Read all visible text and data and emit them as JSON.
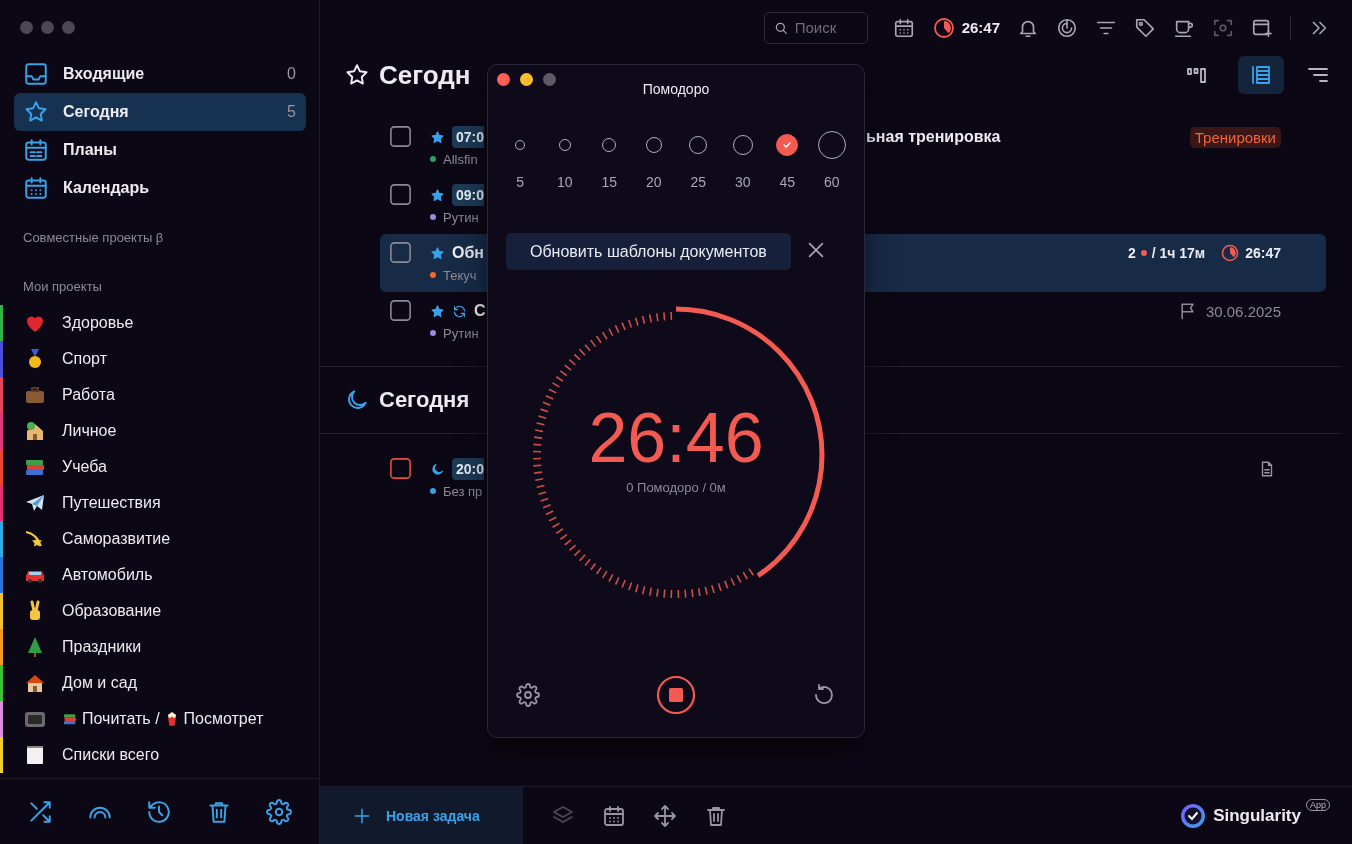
{
  "sidebar": {
    "nav": [
      {
        "label": "Входящие",
        "count": "0",
        "kind": "inbox",
        "selected": false
      },
      {
        "label": "Сегодня",
        "count": "5",
        "kind": "star",
        "selected": true
      },
      {
        "label": "Планы",
        "kind": "plans",
        "selected": false
      },
      {
        "label": "Календарь",
        "kind": "calendar",
        "selected": false
      }
    ],
    "shared_heading": "Совместные проекты β",
    "projects_heading": "Мои проекты",
    "projects": [
      {
        "title": "Здоровье",
        "kind": "heart",
        "color": "#33b249"
      },
      {
        "title": "Спорт",
        "kind": "medal",
        "color": "#4b4fd6"
      },
      {
        "title": "Работа",
        "kind": "briefcase",
        "color": "#e0475a"
      },
      {
        "title": "Личное",
        "kind": "house-tree",
        "color": "#e0367f"
      },
      {
        "title": "Учеба",
        "kind": "books",
        "color": "#e8452d"
      },
      {
        "title": "Путешествия",
        "kind": "plane",
        "color": "#e52e6f"
      },
      {
        "title": "Саморазвитие",
        "kind": "comet",
        "color": "#2fa9e0"
      },
      {
        "title": "Автомобиль",
        "kind": "car",
        "color": "#2d73d9"
      },
      {
        "title": "Образование",
        "kind": "hand",
        "color": "#f2c230"
      },
      {
        "title": "Праздники",
        "kind": "tree",
        "color": "#f29a1f"
      },
      {
        "title": "Дом и сад",
        "kind": "house",
        "color": "#3cc13b"
      },
      {
        "title": "Почитать /",
        "title_cont": "Посмотрет",
        "kind": "tv",
        "color": "#d98ee0"
      },
      {
        "title": "Списки всего",
        "kind": "notepad",
        "color": "#f2d02b"
      }
    ]
  },
  "topbar": {
    "search": {
      "placeholder": "Поиск"
    },
    "timer": "26:47"
  },
  "header": {
    "title": "Сегодн",
    "views": [
      {
        "kind": "columns",
        "selected": false
      },
      {
        "kind": "list",
        "selected": true
      }
    ]
  },
  "tasks": [
    {
      "kind": "star",
      "checked": false,
      "selected": false,
      "high_priority": false,
      "recurring": false,
      "has_note": false,
      "time": "07:0",
      "project": "Allsfin",
      "color": "#2f9e6a",
      "title_tail": "ьная тренировка",
      "tag": "Тренировки"
    },
    {
      "kind": "star",
      "checked": false,
      "selected": false,
      "high_priority": false,
      "recurring": false,
      "has_note": false,
      "time": "09:0",
      "project": "Рутин",
      "color": "#9a8ce0"
    },
    {
      "kind": "star",
      "checked": false,
      "selected": true,
      "high_priority": false,
      "recurring": false,
      "has_note": false,
      "title": "Обн",
      "project": "Текуч",
      "color": "#f06a2b",
      "pomodoros": "2",
      "spent": "/ 1ч 17м",
      "timer": "26:47"
    },
    {
      "kind": "star",
      "checked": false,
      "selected": false,
      "high_priority": false,
      "recurring": true,
      "has_note": false,
      "title": "С",
      "project": "Рутин",
      "color": "#9a8ce0",
      "deadline": "30.06.2025"
    }
  ],
  "evening": {
    "title": "Сегодня",
    "tasks": [
      {
        "kind": "moon",
        "checked": false,
        "selected": false,
        "high_priority": true,
        "recurring": false,
        "has_note": true,
        "time": "20:0",
        "project": "Без пр",
        "color": "#3aa0e6"
      }
    ]
  },
  "bottombar": {
    "new_task": "Новая задача",
    "brand": "Singularity",
    "brand_badge": "App"
  },
  "pomodoro": {
    "title": "Помодоро",
    "durations": [
      {
        "label": "5",
        "selected": false
      },
      {
        "label": "10",
        "selected": false
      },
      {
        "label": "15",
        "selected": false
      },
      {
        "label": "20",
        "selected": false
      },
      {
        "label": "25",
        "selected": false
      },
      {
        "label": "30",
        "selected": false
      },
      {
        "label": "45",
        "selected": true
      },
      {
        "label": "60",
        "selected": false
      }
    ],
    "task": "Обновить шаблоны документов",
    "level": 0.405,
    "remaining": "26:46",
    "summary": "0 Помодоро / 0м"
  }
}
